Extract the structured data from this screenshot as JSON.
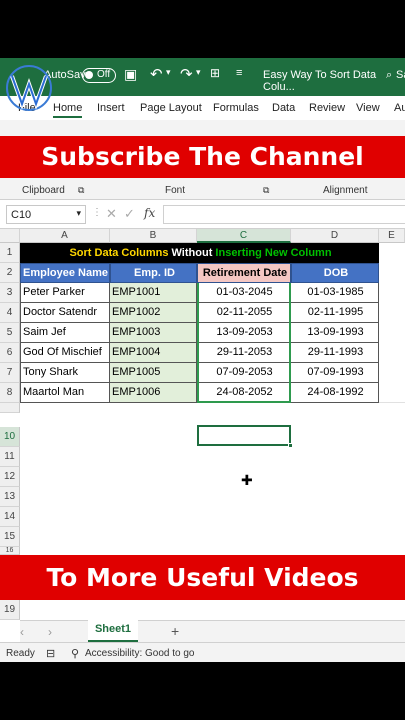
{
  "titlebar": {
    "autosave_label": "AutoSave",
    "toggle_label": "Off",
    "doc_title": "Easy Way To Sort Data Colu...",
    "right_text": "Sa"
  },
  "menu": {
    "items": [
      "File",
      "Home",
      "Insert",
      "Page Layout",
      "Formulas",
      "Data",
      "Review",
      "View",
      "Au"
    ]
  },
  "banners": {
    "top": "Subscribe The Channel",
    "bottom": "To More Useful Videos"
  },
  "ribbon_groups": {
    "clipboard": "Clipboard",
    "font": "Font",
    "alignment": "Alignment"
  },
  "formula_bar": {
    "name_box": "C10",
    "fx": "fx",
    "value": ""
  },
  "columns": [
    "A",
    "B",
    "C",
    "D",
    "E"
  ],
  "rows": [
    "1",
    "2",
    "3",
    "4",
    "5",
    "6",
    "7",
    "8",
    "10",
    "11",
    "12",
    "13",
    "14",
    "15",
    "16",
    "19"
  ],
  "sheet": {
    "title_parts": [
      "Sort Data Columns",
      " Without ",
      "Inserting New Column"
    ],
    "headers": [
      "Employee Name",
      "Emp. ID",
      "Retirement Date",
      "DOB"
    ],
    "data": [
      [
        "Peter Parker",
        "EMP1001",
        "01-03-2045",
        "01-03-1985"
      ],
      [
        "Doctor Satendr",
        "EMP1002",
        "02-11-2055",
        "02-11-1995"
      ],
      [
        "Saim Jef",
        "EMP1003",
        "13-09-2053",
        "13-09-1993"
      ],
      [
        "God Of Mischief",
        "EMP1004",
        "29-11-2053",
        "29-11-1993"
      ],
      [
        "Tony Shark",
        "EMP1005",
        "07-09-2053",
        "07-09-1993"
      ],
      [
        "Maartol Man",
        "EMP1006",
        "24-08-2052",
        "24-08-1992"
      ]
    ]
  },
  "sheet_tab": "Sheet1",
  "add_sheet": "+",
  "status": {
    "ready": "Ready",
    "accessibility": "Accessibility: Good to go"
  },
  "colors": {
    "excel_green": "#1e6e3f",
    "banner_red": "#e00000",
    "header_blue": "#4472c4",
    "title_yellow": "#ffd700",
    "title_green": "#00c000",
    "retire_pink": "#f4c7c3"
  }
}
